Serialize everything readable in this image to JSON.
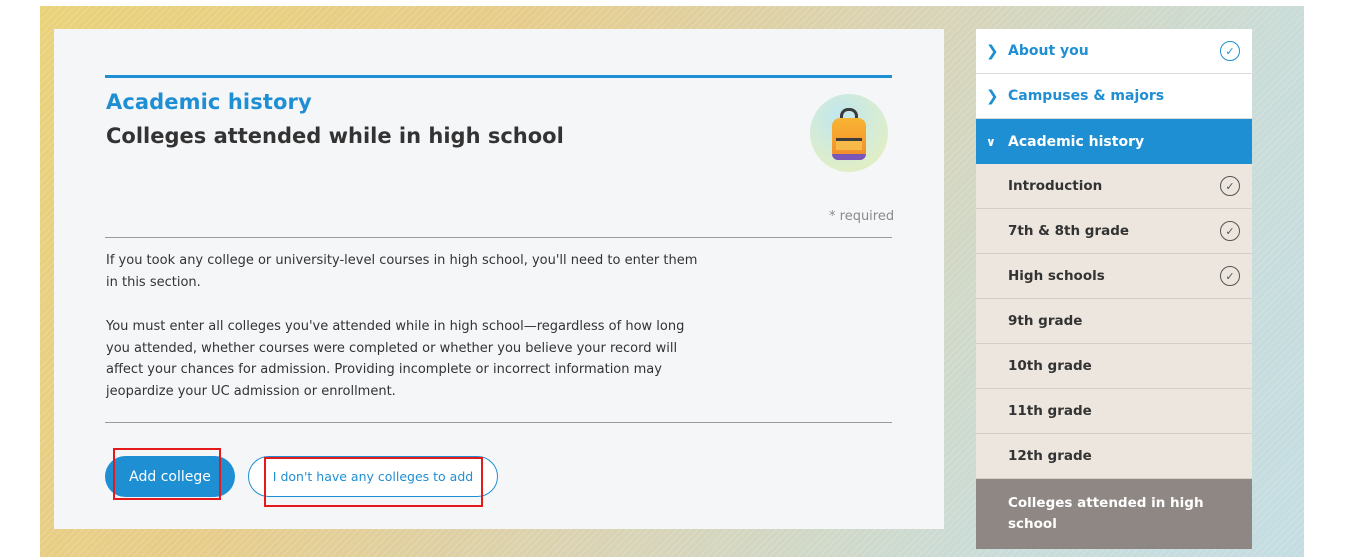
{
  "main": {
    "section_title": "Academic history",
    "page_title": "Colleges attended while in high school",
    "required_note": "* required",
    "paragraph_1": "If you took any college or university-level courses in high school, you'll need to enter them in this section.",
    "paragraph_2": "You must enter all colleges you've attended while in high school—regardless of how long you attended, whether courses were completed or whether you believe your record will affect your chances for admission. Providing incomplete or incorrect information may jeopardize your UC admission or enrollment.",
    "add_college_label": "Add college",
    "no_colleges_label": "I don't have any colleges to add",
    "icon": "backpack-icon"
  },
  "sidebar": {
    "top_items": [
      {
        "label": "About you",
        "completed": true
      },
      {
        "label": "Campuses & majors",
        "completed": false
      }
    ],
    "active_section": "Academic history",
    "sub_items": [
      {
        "label": "Introduction",
        "completed": true
      },
      {
        "label": "7th & 8th grade",
        "completed": true
      },
      {
        "label": "High schools",
        "completed": true
      },
      {
        "label": "9th grade",
        "completed": false
      },
      {
        "label": "10th grade",
        "completed": false
      },
      {
        "label": "11th grade",
        "completed": false
      },
      {
        "label": "12th grade",
        "completed": false
      }
    ],
    "current_item": "Colleges attended in high school"
  },
  "colors": {
    "accent": "#1f8fd4",
    "highlight": "#e3191c",
    "sub_bg": "#ede6df",
    "current_bg": "#8f8783"
  }
}
